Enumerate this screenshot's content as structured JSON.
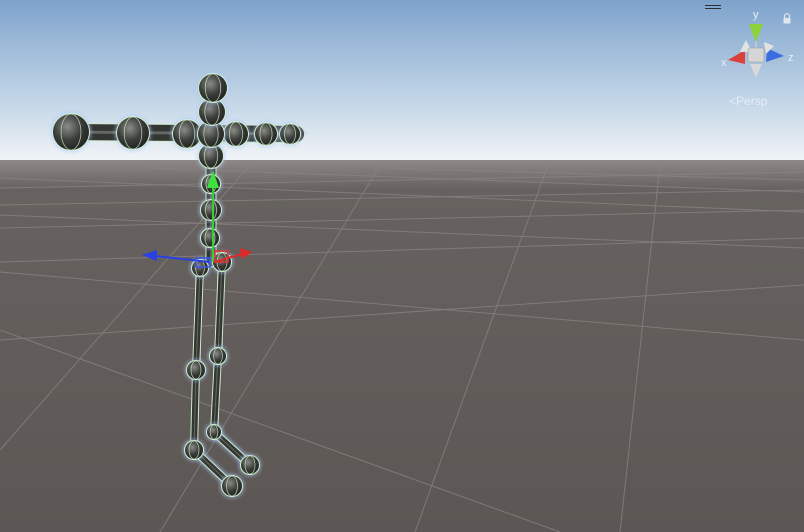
{
  "viewport": {
    "projection_label": "Persp",
    "projection_arrow": "<"
  },
  "gizmo": {
    "axis_x_label": "x",
    "axis_y_label": "y",
    "axis_z_label": "z",
    "colors": {
      "x": "#d9413a",
      "y": "#8ed23a",
      "z": "#3a6ee0",
      "neutral": "#e8e8e8"
    }
  },
  "icons": {
    "menu": "hamburger-icon",
    "lock": "lock-icon"
  },
  "colors": {
    "sky_top": "#86a9cf",
    "sky_horizon": "#eef3f6",
    "ground": "#5e5a57",
    "grid_line": "#7c7774",
    "bone_fill": "#3a3c3a",
    "bone_outline": "#cfeccc",
    "selection_glow": "#9ec3ff",
    "handle_x": "#d92a2a",
    "handle_y": "#3dd43d",
    "handle_z": "#2a3fe0"
  }
}
